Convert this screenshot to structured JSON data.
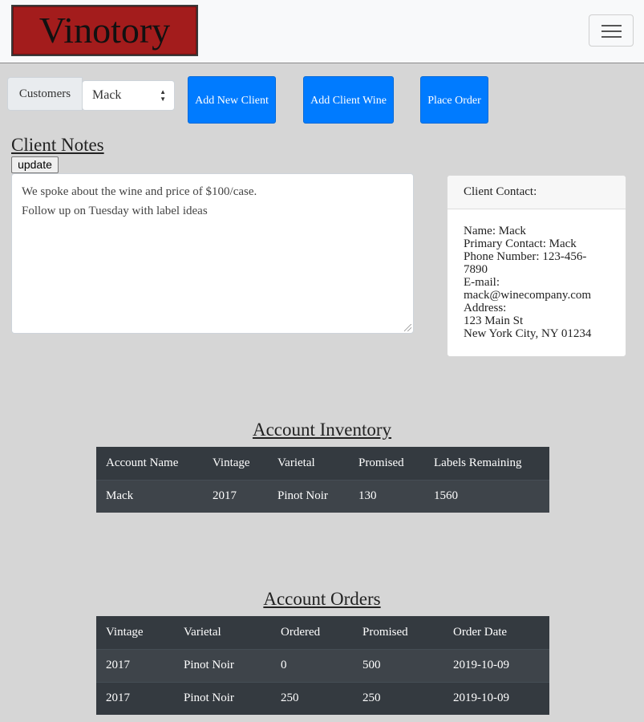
{
  "navbar": {
    "brand": "Vinotory",
    "toggle_icon": "hamburger-menu-icon"
  },
  "customers": {
    "label": "Customers",
    "selected": "Mack"
  },
  "actions": {
    "add_new_client": "Add New Client",
    "add_client_wine": "Add Client Wine",
    "place_order": "Place Order"
  },
  "notes": {
    "title": "Client Notes",
    "update_label": "update",
    "lines": [
      "We spoke about the wine and price of $100/case.",
      "Follow up on Tuesday with label ideas"
    ]
  },
  "contact": {
    "header": "Client Contact:",
    "lines": [
      "Name: Mack",
      "Primary Contact: Mack",
      "Phone Number: 123-456-",
      "7890",
      "E-mail:",
      "mack@winecompany.com",
      "Address:",
      "123 Main St",
      "New York City, NY 01234"
    ]
  },
  "inventory": {
    "title": "Account Inventory",
    "columns": [
      "Account Name",
      "Vintage",
      "Varietal",
      "Promised",
      "Labels Remaining"
    ],
    "rows": [
      [
        "Mack",
        "2017",
        "Pinot Noir",
        "130",
        "1560"
      ]
    ]
  },
  "orders": {
    "title": "Account Orders",
    "columns": [
      "Vintage",
      "Varietal",
      "Ordered",
      "Promised",
      "Order Date"
    ],
    "rows": [
      [
        "2017",
        "Pinot Noir",
        "0",
        "500",
        "2019-10-09"
      ],
      [
        "2017",
        "Pinot Noir",
        "250",
        "250",
        "2019-10-09"
      ]
    ]
  },
  "colors": {
    "brand_bg": "#a31c1c",
    "primary_button": "#007bff",
    "table_dark": "#343a40",
    "page_bg": "#d6d6d6"
  }
}
